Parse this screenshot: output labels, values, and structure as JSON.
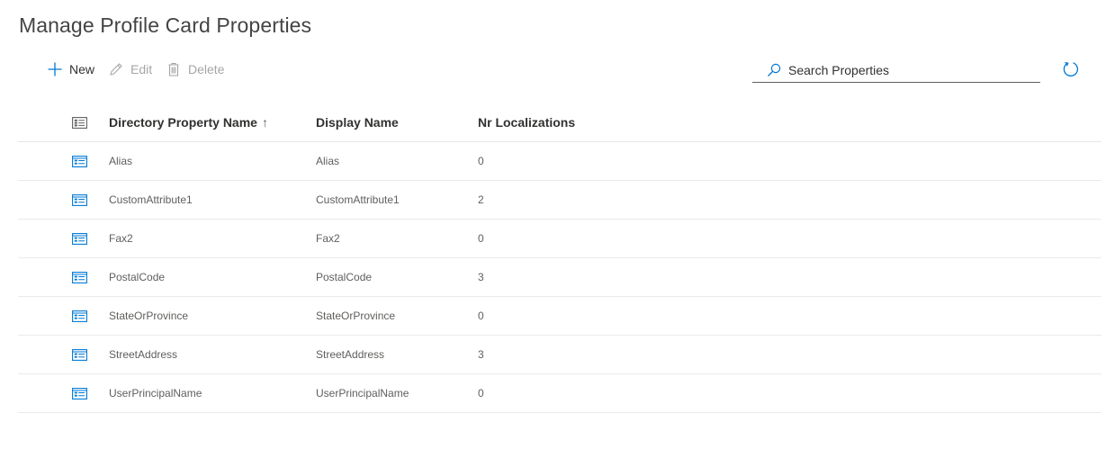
{
  "page": {
    "title": "Manage Profile Card Properties"
  },
  "toolbar": {
    "new_label": "New",
    "edit_label": "Edit",
    "delete_label": "Delete",
    "search_placeholder": "Search Properties"
  },
  "colors": {
    "accent": "#0078d4",
    "disabled": "#a6a6a6",
    "text": "#323130"
  },
  "icons": {
    "new": "plus-icon",
    "edit": "pencil-icon",
    "delete": "trash-icon",
    "search": "search-icon",
    "refresh": "refresh-icon",
    "row": "property-card-icon"
  },
  "table": {
    "columns": [
      {
        "label": "Directory Property Name",
        "sort": "ascending",
        "sort_glyph": "↑"
      },
      {
        "label": "Display Name"
      },
      {
        "label": "Nr Localizations"
      }
    ],
    "rows": [
      {
        "name": "Alias",
        "display": "Alias",
        "localizations": "0"
      },
      {
        "name": "CustomAttribute1",
        "display": "CustomAttribute1",
        "localizations": "2"
      },
      {
        "name": "Fax2",
        "display": "Fax2",
        "localizations": "0"
      },
      {
        "name": "PostalCode",
        "display": "PostalCode",
        "localizations": "3"
      },
      {
        "name": "StateOrProvince",
        "display": "StateOrProvince",
        "localizations": "0"
      },
      {
        "name": "StreetAddress",
        "display": "StreetAddress",
        "localizations": "3"
      },
      {
        "name": "UserPrincipalName",
        "display": "UserPrincipalName",
        "localizations": "0"
      }
    ]
  }
}
